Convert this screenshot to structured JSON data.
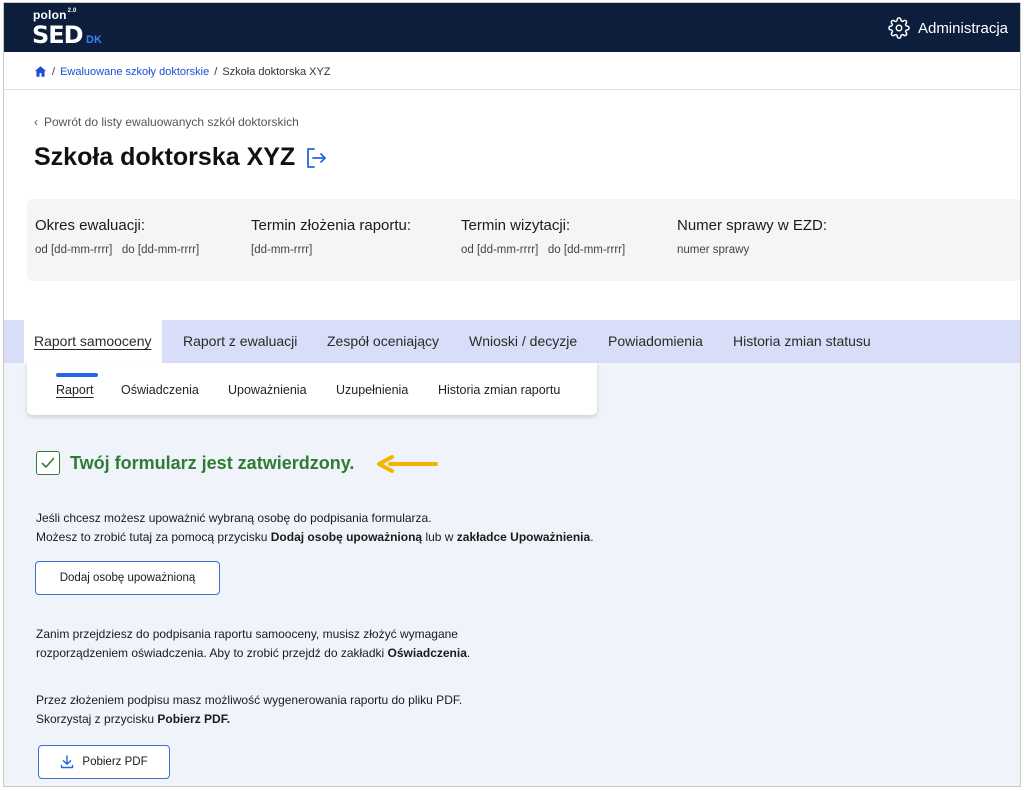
{
  "app": {
    "logo_top": "polon",
    "logo_sup": "2.0",
    "logo_main": "SED",
    "logo_suffix": "DK",
    "admin_label": "Administracja"
  },
  "breadcrumb": {
    "items": [
      "Ewaluowane szkoły doktorskie",
      "Szkoła doktorska XYZ"
    ]
  },
  "header": {
    "back_label": "Powrót do listy ewaluowanych szkół doktorskich",
    "title": "Szkoła doktorska XYZ"
  },
  "info": [
    {
      "label": "Okres ewaluacji:",
      "value": "od [dd-mm-rrrr]   do [dd-mm-rrrr]"
    },
    {
      "label": "Termin złożenia raportu:",
      "value": "[dd-mm-rrrr]"
    },
    {
      "label": "Termin wizytacji:",
      "value": "od [dd-mm-rrrr]   do [dd-mm-rrrr]"
    },
    {
      "label": "Numer sprawy w EZD:",
      "value": "numer sprawy"
    }
  ],
  "tabs": [
    {
      "label": "Raport samooceny",
      "active": true
    },
    {
      "label": "Raport z ewaluacji"
    },
    {
      "label": "Zespół oceniający"
    },
    {
      "label": "Wnioski / decyzje"
    },
    {
      "label": "Powiadomienia"
    },
    {
      "label": "Historia zmian statusu"
    }
  ],
  "subtabs": [
    {
      "label": "Raport",
      "active": true
    },
    {
      "label": "Oświadczenia"
    },
    {
      "label": "Upoważnienia"
    },
    {
      "label": "Uzupełnienia"
    },
    {
      "label": "Historia zmian raportu"
    }
  ],
  "status": {
    "text": "Twój formularz jest zatwierdzony.",
    "color": "#2e7d32",
    "arrow_color": "#f5b301"
  },
  "section1": {
    "line1": "Jeśli chcesz możesz upoważnić wybraną osobę do podpisania formularza.",
    "line2_a": "Możesz to zrobić tutaj za pomocą przycisku ",
    "line2_b": "Dodaj osobę upoważnioną",
    "line2_c": " lub w ",
    "line2_d": "zakładce Upoważnienia",
    "line2_e": ".",
    "button": "Dodaj osobę upoważnioną"
  },
  "section2": {
    "line1": "Zanim przejdziesz do podpisania raportu samooceny, musisz złożyć wymagane",
    "line2_a": "rozporządzeniem oświadczenia. Aby to zrobić przejdź do zakładki ",
    "line2_b": "Oświadczenia",
    "line2_c": "."
  },
  "section3": {
    "line1": "Przez złożeniem podpisu masz możliwość wygenerowania raportu do pliku PDF.",
    "line2_a": "Skorzystaj z przycisku ",
    "line2_b": "Pobierz PDF.",
    "button": "Pobierz PDF"
  }
}
